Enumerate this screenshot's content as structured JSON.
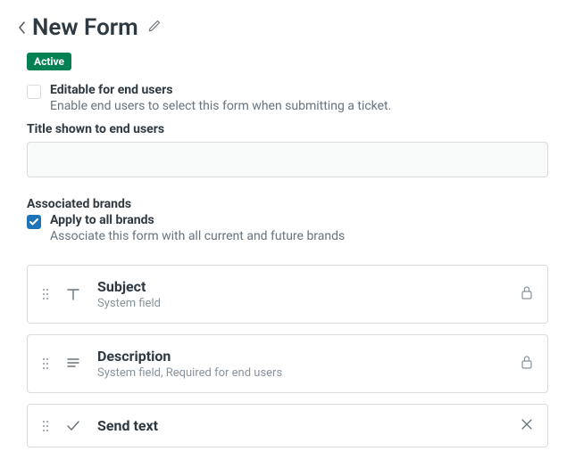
{
  "header": {
    "title": "New Form"
  },
  "status": {
    "badge": "Active"
  },
  "editable": {
    "label": "Editable for end users",
    "description": "Enable end users to select this form when submitting a ticket."
  },
  "titleField": {
    "label": "Title shown to end users",
    "value": ""
  },
  "brands": {
    "sectionLabel": "Associated brands",
    "applyLabel": "Apply to all brands",
    "applyDescription": "Associate this form with all current and future brands"
  },
  "fields": [
    {
      "title": "Subject",
      "sub": "System field",
      "icon": "text",
      "locked": true
    },
    {
      "title": "Description",
      "sub": "System field, Required for end users",
      "icon": "multiline",
      "locked": true
    },
    {
      "title": "Send text",
      "sub": "",
      "icon": "check",
      "locked": false
    }
  ]
}
